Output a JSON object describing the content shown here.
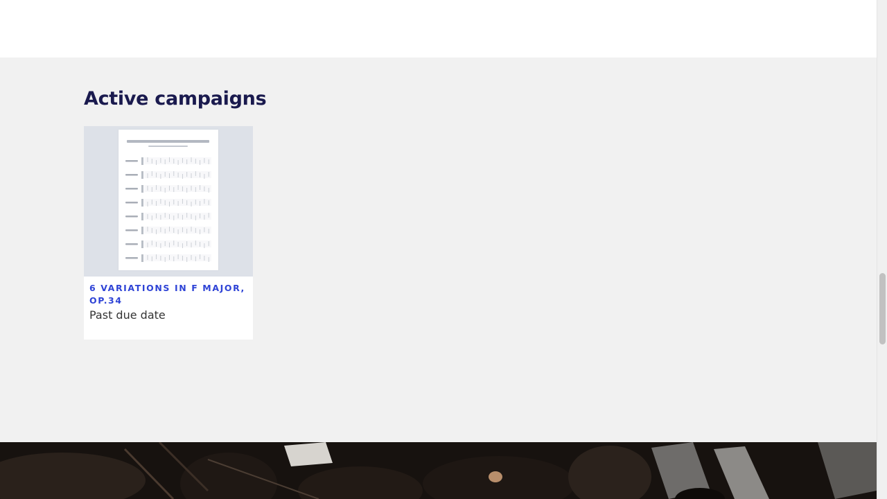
{
  "section": {
    "title": "Active campaigns"
  },
  "campaigns": [
    {
      "title": "6 VARIATIONS IN F MAJOR, OP.34",
      "status": "Past due date",
      "thumbnail_icon": "sheet-music-thumbnail"
    }
  ],
  "footer": {
    "image": "orchestra-performance-photo"
  },
  "colors": {
    "title": "#1a1a4e",
    "card_title": "#2e43d6",
    "section_bg": "#f1f1f1",
    "thumb_bg": "#dde1e8"
  }
}
